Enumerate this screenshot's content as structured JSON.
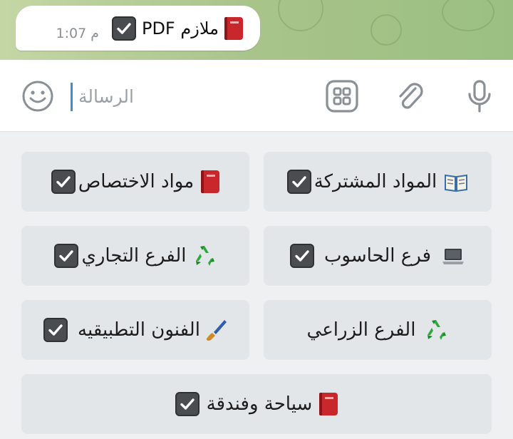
{
  "message": {
    "text": "ملازم PDF",
    "time": "1:07 م"
  },
  "input": {
    "placeholder": "الرسالة"
  },
  "icons": {
    "emoji": "smiley-icon",
    "commands": "bot-keyboard-icon",
    "attach": "paperclip-icon",
    "voice": "microphone-icon"
  },
  "keyboard": {
    "buttons": [
      {
        "label": "مواد الاختصاص",
        "icon": "red-book-icon",
        "checked": true
      },
      {
        "label": "المواد المشتركة",
        "icon": "open-book-icon",
        "checked": true
      },
      {
        "label": "الفرع التجاري",
        "icon": "recycle-icon",
        "checked": true
      },
      {
        "label": "فرع الحاسوب",
        "icon": "laptop-icon",
        "checked": true
      },
      {
        "label": "الفنون التطبيقيه",
        "icon": "paintbrush-icon",
        "checked": true
      },
      {
        "label": "الفرع الزراعي",
        "icon": "recycle-icon",
        "checked": false
      },
      {
        "label": "سياحة وفندقة",
        "icon": "red-book-icon",
        "checked": true
      }
    ]
  },
  "colors": {
    "accent": "#3d8bdb",
    "button_bg": "#e3e6e9",
    "panel_bg": "#eef0f2",
    "wallpaper": "#a8c48a"
  }
}
